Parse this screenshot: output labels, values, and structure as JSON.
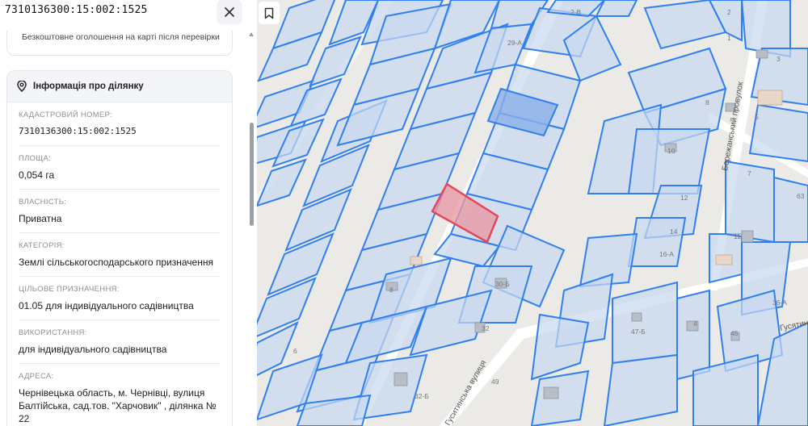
{
  "header": {
    "cadastral_title": "7310136300:15:002:1525"
  },
  "promo": {
    "text": "Безкоштовне оголошення на карті після перевірки"
  },
  "info": {
    "title": "Інформація про ділянку",
    "fields": [
      {
        "label": "КАДАСТРОВИЙ НОМЕР:",
        "value": "7310136300:15:002:1525"
      },
      {
        "label": "ПЛОЩА:",
        "value": "0,054 га"
      },
      {
        "label": "ВЛАСНІСТЬ:",
        "value": "Приватна"
      },
      {
        "label": "КАТЕГОРІЯ:",
        "value": "Землі сільськогосподарського призначення"
      },
      {
        "label": "ЦІЛЬОВЕ ПРИЗНАЧЕННЯ:",
        "value": "01.05 для індивідуального садівництва"
      },
      {
        "label": "ВИКОРИСТАННЯ:",
        "value": "для індивідуального садівництва"
      },
      {
        "label": "АДРЕСА:",
        "value": "Чернівецька область, м. Чернівці, вулиця Балтійська, сад.тов. \"Харчовик\" , ділянка № 22"
      }
    ]
  },
  "icons": {
    "close": "close-icon",
    "bookmark": "bookmark-icon",
    "location": "location-pin-icon"
  },
  "map": {
    "street_labels": [
      "Гуситинська вулиця",
      "Бережанський провулок",
      "Гусятин"
    ],
    "house_numbers": [
      "2-В",
      "29-А",
      "2",
      "1",
      "3",
      "8",
      "5",
      "10",
      "7",
      "12",
      "63",
      "14",
      "11",
      "16-А",
      "30-Б",
      "47-Б",
      "32",
      "4",
      "45",
      "36-А",
      "6",
      "49",
      "32-Б",
      "8"
    ],
    "colors": {
      "parcel": "#2f7ff0",
      "parcel_fill": "#c8d8f0",
      "selected": "#e0485a",
      "road": "#ffffff",
      "ground": "#eceae6"
    }
  }
}
